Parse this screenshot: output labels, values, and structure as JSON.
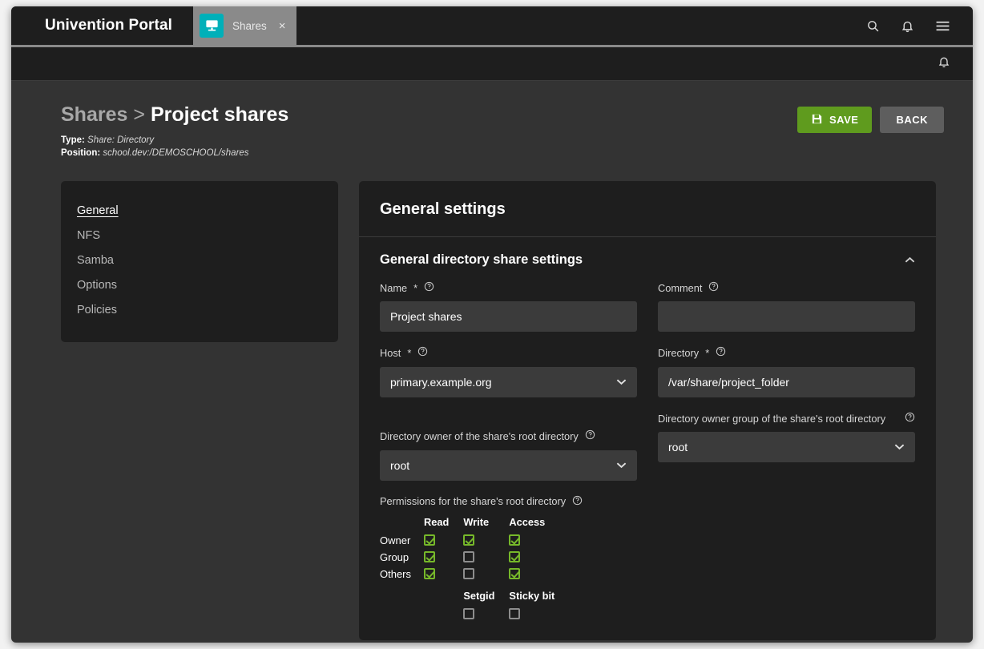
{
  "colors": {
    "accent_teal": "#00b0b9",
    "save_green": "#5f9b1e",
    "check_green": "#76b82a",
    "panel_bg": "#1e1e1e",
    "page_bg": "#333333",
    "input_bg": "#3b3b3b"
  },
  "topbar": {
    "brand": "Univention Portal",
    "tab": {
      "label": "Shares",
      "close": "×",
      "icon": "shares-monitor-icon"
    },
    "icons": [
      {
        "name": "search-icon"
      },
      {
        "name": "notifications-bell-icon"
      },
      {
        "name": "hamburger-menu-icon"
      }
    ]
  },
  "subbar": {
    "icon": "notifications-bell-icon"
  },
  "page": {
    "breadcrumb_parent": "Shares",
    "breadcrumb_separator": ">",
    "breadcrumb_current": "Project shares",
    "type_label": "Type:",
    "type_value": "Share: Directory",
    "position_label": "Position:",
    "position_value": "school.dev:/DEMOSCHOOL/shares",
    "save_label": "SAVE",
    "back_label": "BACK"
  },
  "sidebar": {
    "items": [
      {
        "label": "General",
        "active": true
      },
      {
        "label": "NFS",
        "active": false
      },
      {
        "label": "Samba",
        "active": false
      },
      {
        "label": "Options",
        "active": false
      },
      {
        "label": "Policies",
        "active": false
      }
    ]
  },
  "panel": {
    "title": "General settings",
    "section_title": "General directory share settings",
    "collapse_icon": "chevron-up-icon",
    "help_icon": "help-circle-icon",
    "fields": {
      "name": {
        "label": "Name",
        "required": "*",
        "value": "Project shares"
      },
      "comment": {
        "label": "Comment",
        "required": "",
        "value": ""
      },
      "host": {
        "label": "Host",
        "required": "*",
        "value": "primary.example.org"
      },
      "directory": {
        "label": "Directory",
        "required": "*",
        "value": "/var/share/project_folder"
      },
      "dir_owner": {
        "label": "Directory owner of the share's root directory",
        "value": "root"
      },
      "dir_owner_group": {
        "label": "Directory owner group of the share's root directory",
        "value": "root"
      }
    },
    "permissions": {
      "label": "Permissions for the share's root directory",
      "columns": [
        "Read",
        "Write",
        "Access"
      ],
      "rows": [
        {
          "name": "Owner",
          "values": [
            true,
            true,
            true
          ]
        },
        {
          "name": "Group",
          "values": [
            true,
            false,
            true
          ]
        },
        {
          "name": "Others",
          "values": [
            true,
            false,
            true
          ]
        }
      ],
      "extra_columns": [
        "Setgid",
        "Sticky bit"
      ],
      "extra_values": [
        false,
        false
      ]
    }
  }
}
